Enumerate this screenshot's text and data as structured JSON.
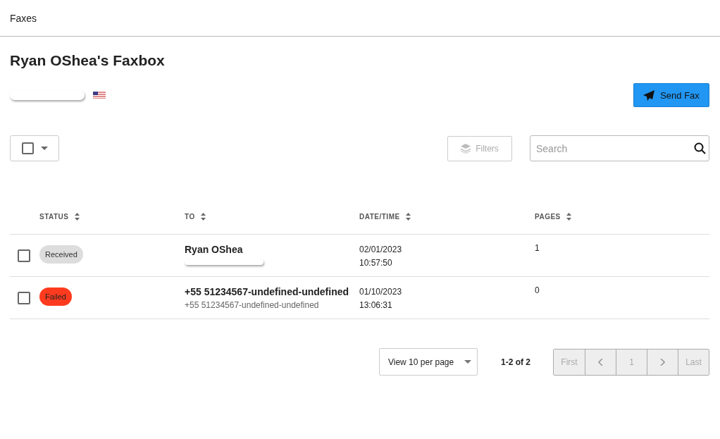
{
  "header": {
    "title": "Faxes"
  },
  "page_title": "Ryan OShea's Faxbox",
  "send_button": "Send Fax",
  "toolbar": {
    "select_all_checked": false,
    "filters": {
      "label": "Filters",
      "disabled": true
    },
    "search": {
      "placeholder": "Search"
    }
  },
  "table": {
    "columns": [
      "STATUS",
      "TO",
      "DATE/TIME",
      "PAGES"
    ],
    "rows": [
      {
        "checked": false,
        "status": {
          "label": "Received",
          "kind": "received"
        },
        "to": "Ryan OShea",
        "to_detail_hidden": true,
        "date": "02/01/2023",
        "time": "10:57:50",
        "pages": "1"
      },
      {
        "checked": false,
        "status": {
          "label": "Failed",
          "kind": "failed"
        },
        "to": "+55 51234567-undefined-undefined",
        "to_detail": "+55 51234567-undefined-undefined",
        "date": "01/10/2023",
        "time": "13:06:31",
        "pages": "0"
      }
    ]
  },
  "pagination": {
    "per_page": "View 10 per page",
    "range": "1-2 of 2",
    "buttons": [
      {
        "label": "First",
        "kind": "text"
      },
      {
        "kind": "prev"
      },
      {
        "label": "1",
        "kind": "text"
      },
      {
        "kind": "next"
      },
      {
        "label": "Last",
        "kind": "text"
      }
    ]
  }
}
